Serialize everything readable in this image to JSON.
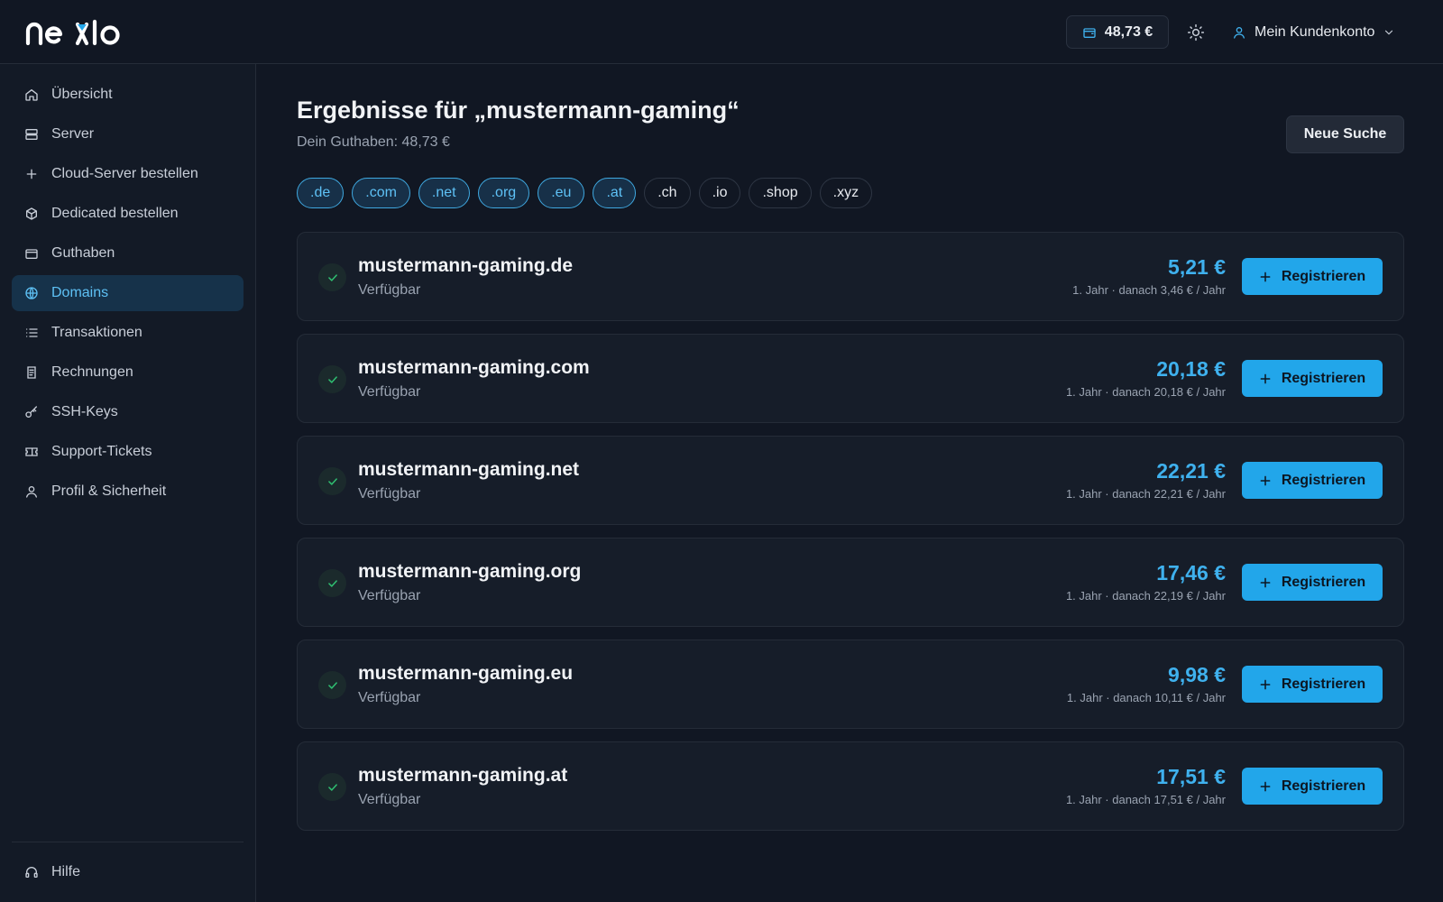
{
  "header": {
    "logo_text": "nexlo",
    "balance": "48,73 €",
    "account_label": "Mein Kundenkonto"
  },
  "sidebar": {
    "items": [
      {
        "label": "Übersicht",
        "icon": "home-icon"
      },
      {
        "label": "Server",
        "icon": "server-icon"
      },
      {
        "label": "Cloud-Server bestellen",
        "icon": "plus-icon"
      },
      {
        "label": "Dedicated bestellen",
        "icon": "box-icon"
      },
      {
        "label": "Guthaben",
        "icon": "wallet-icon"
      },
      {
        "label": "Domains",
        "icon": "globe-icon",
        "active": true
      },
      {
        "label": "Transaktionen",
        "icon": "list-icon"
      },
      {
        "label": "Rechnungen",
        "icon": "receipt-icon"
      },
      {
        "label": "SSH-Keys",
        "icon": "key-icon"
      },
      {
        "label": "Support-Tickets",
        "icon": "ticket-icon"
      },
      {
        "label": "Profil & Sicherheit",
        "icon": "user-icon"
      }
    ],
    "help_label": "Hilfe"
  },
  "main": {
    "title": "Ergebnisse für „mustermann-gaming“",
    "subtitle": "Dein Guthaben: 48,73 €",
    "new_search_label": "Neue Suche",
    "tlds": [
      {
        "label": ".de",
        "selected": true
      },
      {
        "label": ".com",
        "selected": true
      },
      {
        "label": ".net",
        "selected": true
      },
      {
        "label": ".org",
        "selected": true
      },
      {
        "label": ".eu",
        "selected": true
      },
      {
        "label": ".at",
        "selected": true
      },
      {
        "label": ".ch",
        "selected": false
      },
      {
        "label": ".io",
        "selected": false
      },
      {
        "label": ".shop",
        "selected": false
      },
      {
        "label": ".xyz",
        "selected": false
      }
    ],
    "results": [
      {
        "domain": "mustermann-gaming.de",
        "status": "Verfügbar",
        "price": "5,21 €",
        "note": "1. Jahr · danach 3,46 € / Jahr",
        "button": "Registrieren"
      },
      {
        "domain": "mustermann-gaming.com",
        "status": "Verfügbar",
        "price": "20,18 €",
        "note": "1. Jahr · danach 20,18 € / Jahr",
        "button": "Registrieren"
      },
      {
        "domain": "mustermann-gaming.net",
        "status": "Verfügbar",
        "price": "22,21 €",
        "note": "1. Jahr · danach 22,21 € / Jahr",
        "button": "Registrieren"
      },
      {
        "domain": "mustermann-gaming.org",
        "status": "Verfügbar",
        "price": "17,46 €",
        "note": "1. Jahr · danach 22,19 € / Jahr",
        "button": "Registrieren"
      },
      {
        "domain": "mustermann-gaming.eu",
        "status": "Verfügbar",
        "price": "9,98 €",
        "note": "1. Jahr · danach 10,11 € / Jahr",
        "button": "Registrieren"
      },
      {
        "domain": "mustermann-gaming.at",
        "status": "Verfügbar",
        "price": "17,51 €",
        "note": "1. Jahr · danach 17,51 € / Jahr",
        "button": "Registrieren"
      }
    ]
  },
  "colors": {
    "accent": "#22a6ea",
    "price": "#3fb1ee",
    "available": "#2fbf71",
    "background": "#111723"
  }
}
